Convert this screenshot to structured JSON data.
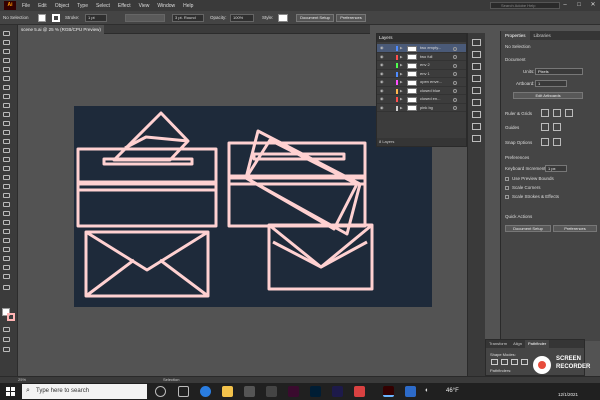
{
  "menu": {
    "logo": "Ai",
    "items": [
      "File",
      "Edit",
      "Object",
      "Type",
      "Select",
      "Effect",
      "View",
      "Window",
      "Help"
    ],
    "search_placeholder": "Search Adobe Help"
  },
  "control_bar": {
    "selection": "No Selection",
    "stroke_label": "Stroke:",
    "stroke_value": "1 pt",
    "brush": "3 pt. Round",
    "opacity_label": "Opacity:",
    "opacity_value": "100%",
    "style_label": "Style:",
    "doc_setup": "Document Setup",
    "preferences": "Preferences"
  },
  "document_tab": "scene 5.ai @ 25 % (RGB/CPU Preview)",
  "layers_panel": {
    "title": "Layers",
    "layers": [
      {
        "name": "two empty...",
        "color": "#4f8cff"
      },
      {
        "name": "two full",
        "color": "#ff4f4f"
      },
      {
        "name": "env 2",
        "color": "#4fff4f"
      },
      {
        "name": "env 1",
        "color": "#4f8cff"
      },
      {
        "name": "open enve...",
        "color": "#ff4fff"
      },
      {
        "name": "closed blue",
        "color": "#ffb84f"
      },
      {
        "name": "closed en...",
        "color": "#ff4f4f"
      },
      {
        "name": "pink bg",
        "color": "#cfcfcf"
      }
    ],
    "footer": "8 Layers"
  },
  "properties": {
    "tab_properties": "Properties",
    "tab_libraries": "Libraries",
    "no_selection": "No Selection",
    "document_heading": "Document",
    "units_label": "Units:",
    "units_value": "Pixels",
    "artboard_label": "Artboard:",
    "artboard_value": "1",
    "edit_artboards": "Edit Artboards",
    "rulers_heading": "Ruler & Grids",
    "guides_heading": "Guides",
    "snap_heading": "Snap Options",
    "preferences_heading": "Preferences",
    "keyboard_label": "Keyboard Increment:",
    "keyboard_value": "1 px",
    "check_preview": "Use Preview Bounds",
    "check_corners": "Scale Corners",
    "check_strokes": "Scale Strokes & Effects",
    "quick_actions": "Quick Actions",
    "doc_setup_btn": "Document Setup",
    "prefs_btn": "Preferences"
  },
  "pathfinder": {
    "tab_transform": "Transform",
    "tab_align": "Align",
    "tab_pathfinder": "Pathfinder",
    "shape_modes": "Shape Modes:",
    "pathfinders": "Pathfinders:"
  },
  "status": {
    "zoom": "25%",
    "tool": "Selection"
  },
  "taskbar": {
    "search_placeholder": "Type here to search",
    "weather": "46°F",
    "date": "12/1/2021"
  },
  "watermark": {
    "line1": "SCREEN",
    "line2": "RECORDER"
  },
  "colors": {
    "canvas": "#1e2a3a",
    "stroke": "#ffd1d1"
  }
}
